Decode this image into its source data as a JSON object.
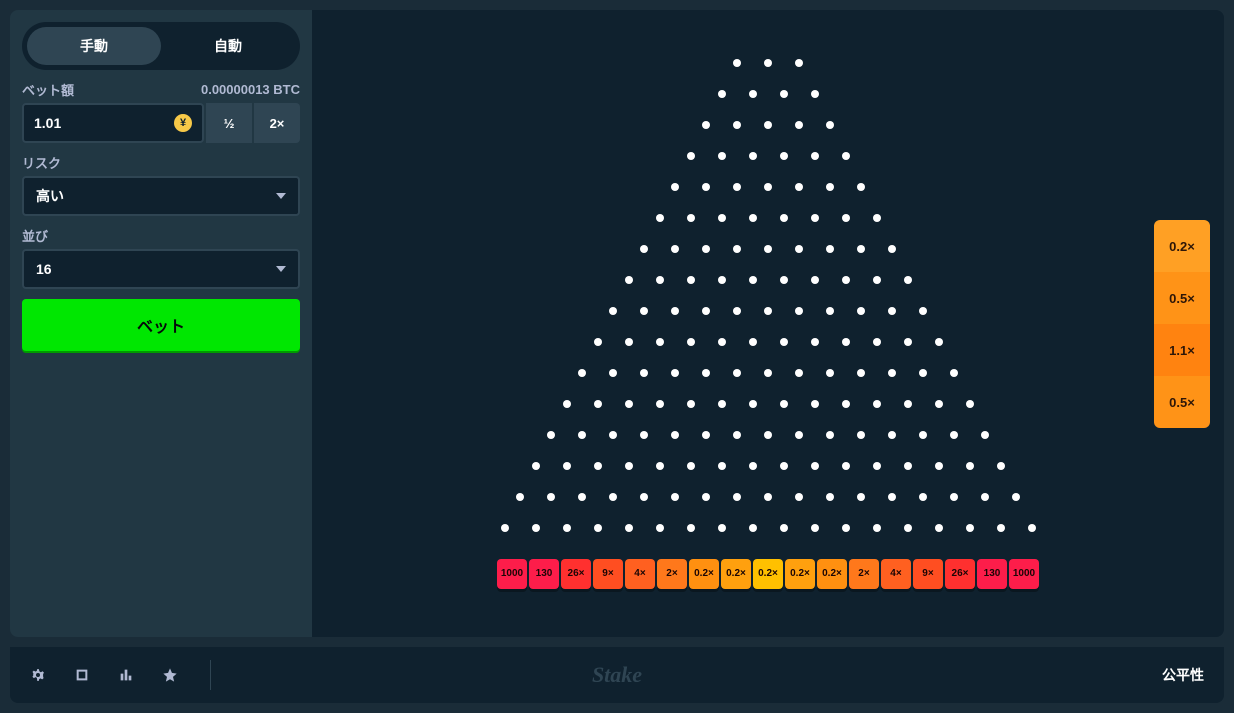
{
  "tabs": {
    "manual": "手動",
    "auto": "自動"
  },
  "bet": {
    "label": "ベット額",
    "btc": "0.00000013 BTC",
    "value": "1.01",
    "half": "½",
    "double": "2×"
  },
  "risk": {
    "label": "リスク",
    "value": "高い"
  },
  "rows": {
    "label": "並び",
    "value": "16"
  },
  "betButton": "ベット",
  "slots": [
    {
      "v": "1000",
      "c": "#fd1d4a"
    },
    {
      "v": "130",
      "c": "#fd1d4a"
    },
    {
      "v": "26×",
      "c": "#ff302f"
    },
    {
      "v": "9×",
      "c": "#ff4e21"
    },
    {
      "v": "4×",
      "c": "#ff6020"
    },
    {
      "v": "2×",
      "c": "#ff781b"
    },
    {
      "v": "0.2×",
      "c": "#ff9010"
    },
    {
      "v": "0.2×",
      "c": "#ffa00e"
    },
    {
      "v": "0.2×",
      "c": "#ffc000"
    },
    {
      "v": "0.2×",
      "c": "#ffa00e"
    },
    {
      "v": "0.2×",
      "c": "#ff9010"
    },
    {
      "v": "2×",
      "c": "#ff781b"
    },
    {
      "v": "4×",
      "c": "#ff6020"
    },
    {
      "v": "9×",
      "c": "#ff4e21"
    },
    {
      "v": "26×",
      "c": "#ff302f"
    },
    {
      "v": "130",
      "c": "#fd1d4a"
    },
    {
      "v": "1000",
      "c": "#fd1d4a"
    }
  ],
  "history": [
    {
      "v": "0.2×",
      "c": "#ffa024"
    },
    {
      "v": "0.5×",
      "c": "#ff9317"
    },
    {
      "v": "1.1×",
      "c": "#ff8310"
    },
    {
      "v": "0.5×",
      "c": "#ff9317"
    }
  ],
  "pegRows": 16,
  "footer": {
    "brand": "Stake",
    "fairness": "公平性"
  }
}
